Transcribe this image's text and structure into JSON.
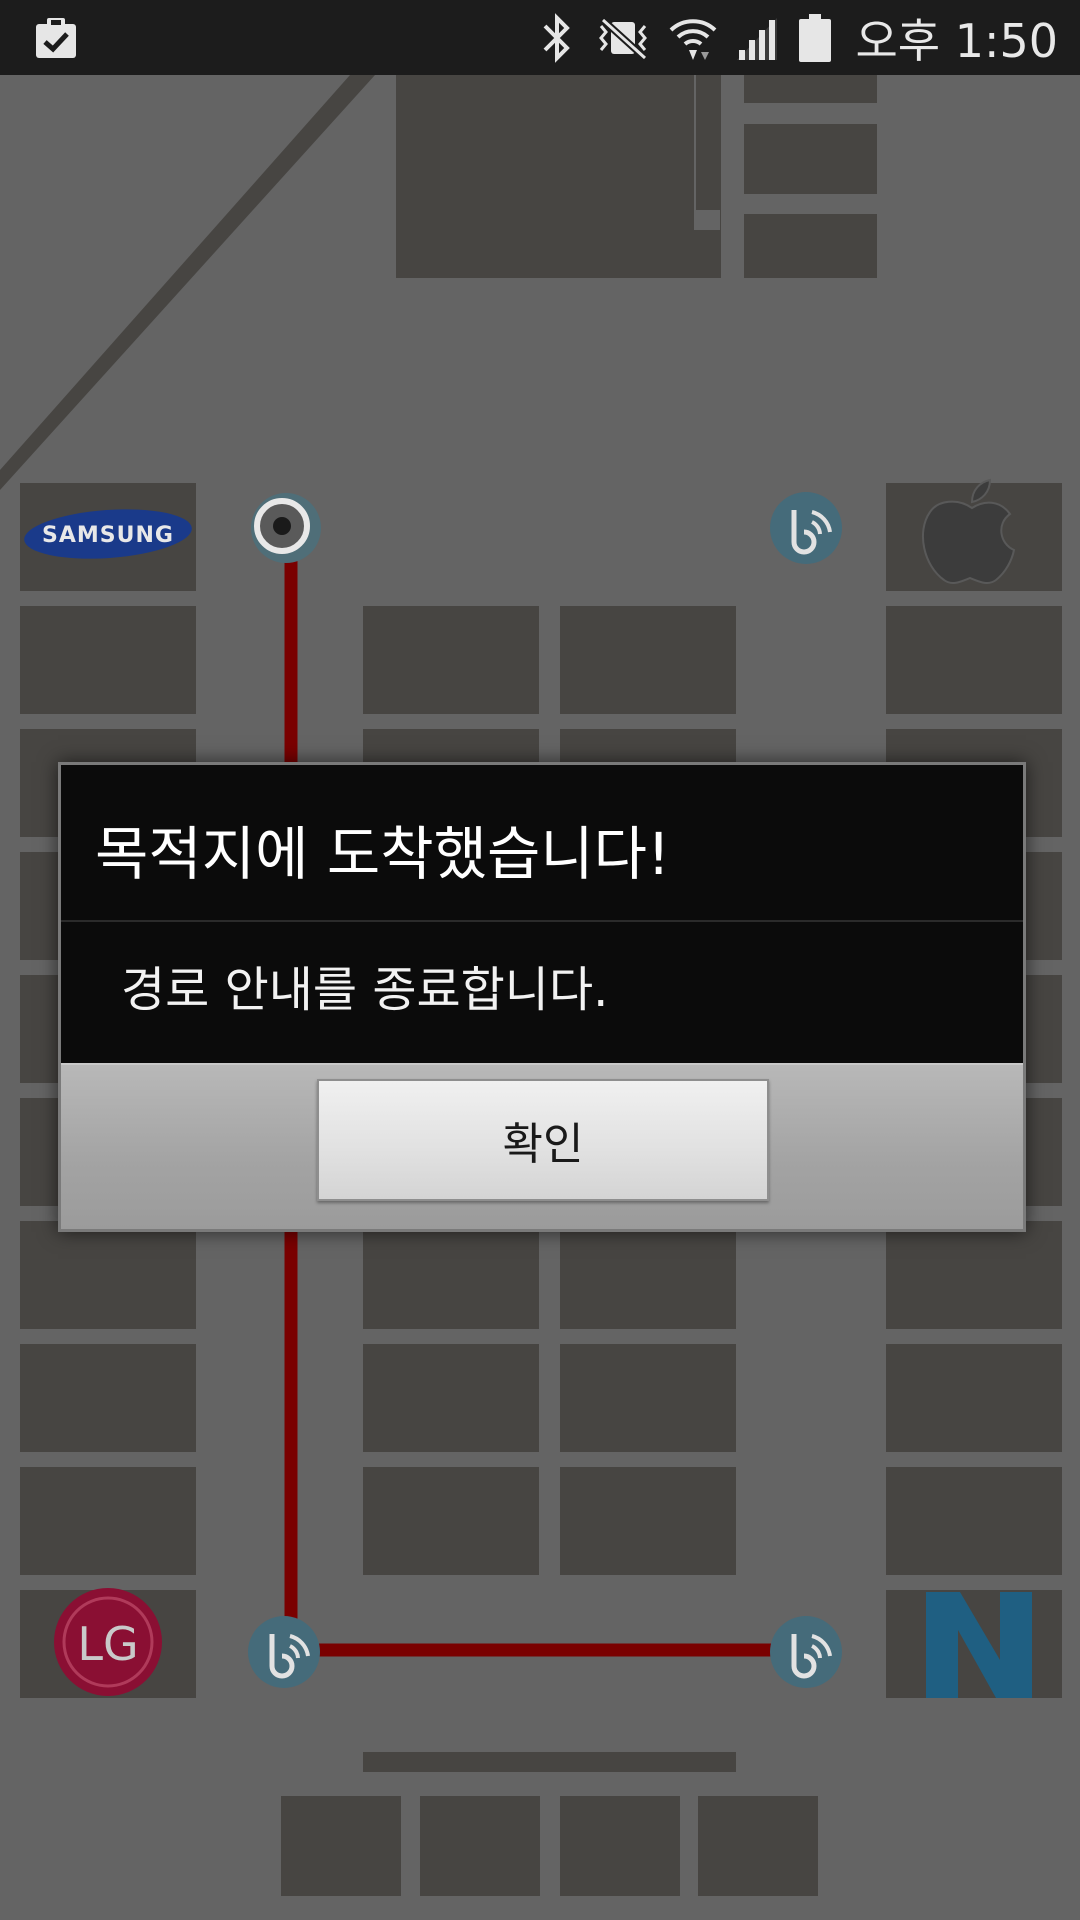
{
  "status_bar": {
    "time": "오후 1:50",
    "icons": [
      "clipboard-check-icon",
      "bluetooth-icon",
      "vibrate-icon",
      "wifi-icon",
      "signal-icon",
      "battery-icon"
    ]
  },
  "map": {
    "route_color": "#7a0000",
    "block_color": "#474542",
    "background_color": "#646464",
    "store_logos": [
      "SAMSUNG",
      "apple-logo",
      "LG",
      "N"
    ]
  },
  "dialog": {
    "title": "목적지에 도착했습니다!",
    "message": "경로 안내를 종료합니다.",
    "confirm_label": "확인"
  }
}
